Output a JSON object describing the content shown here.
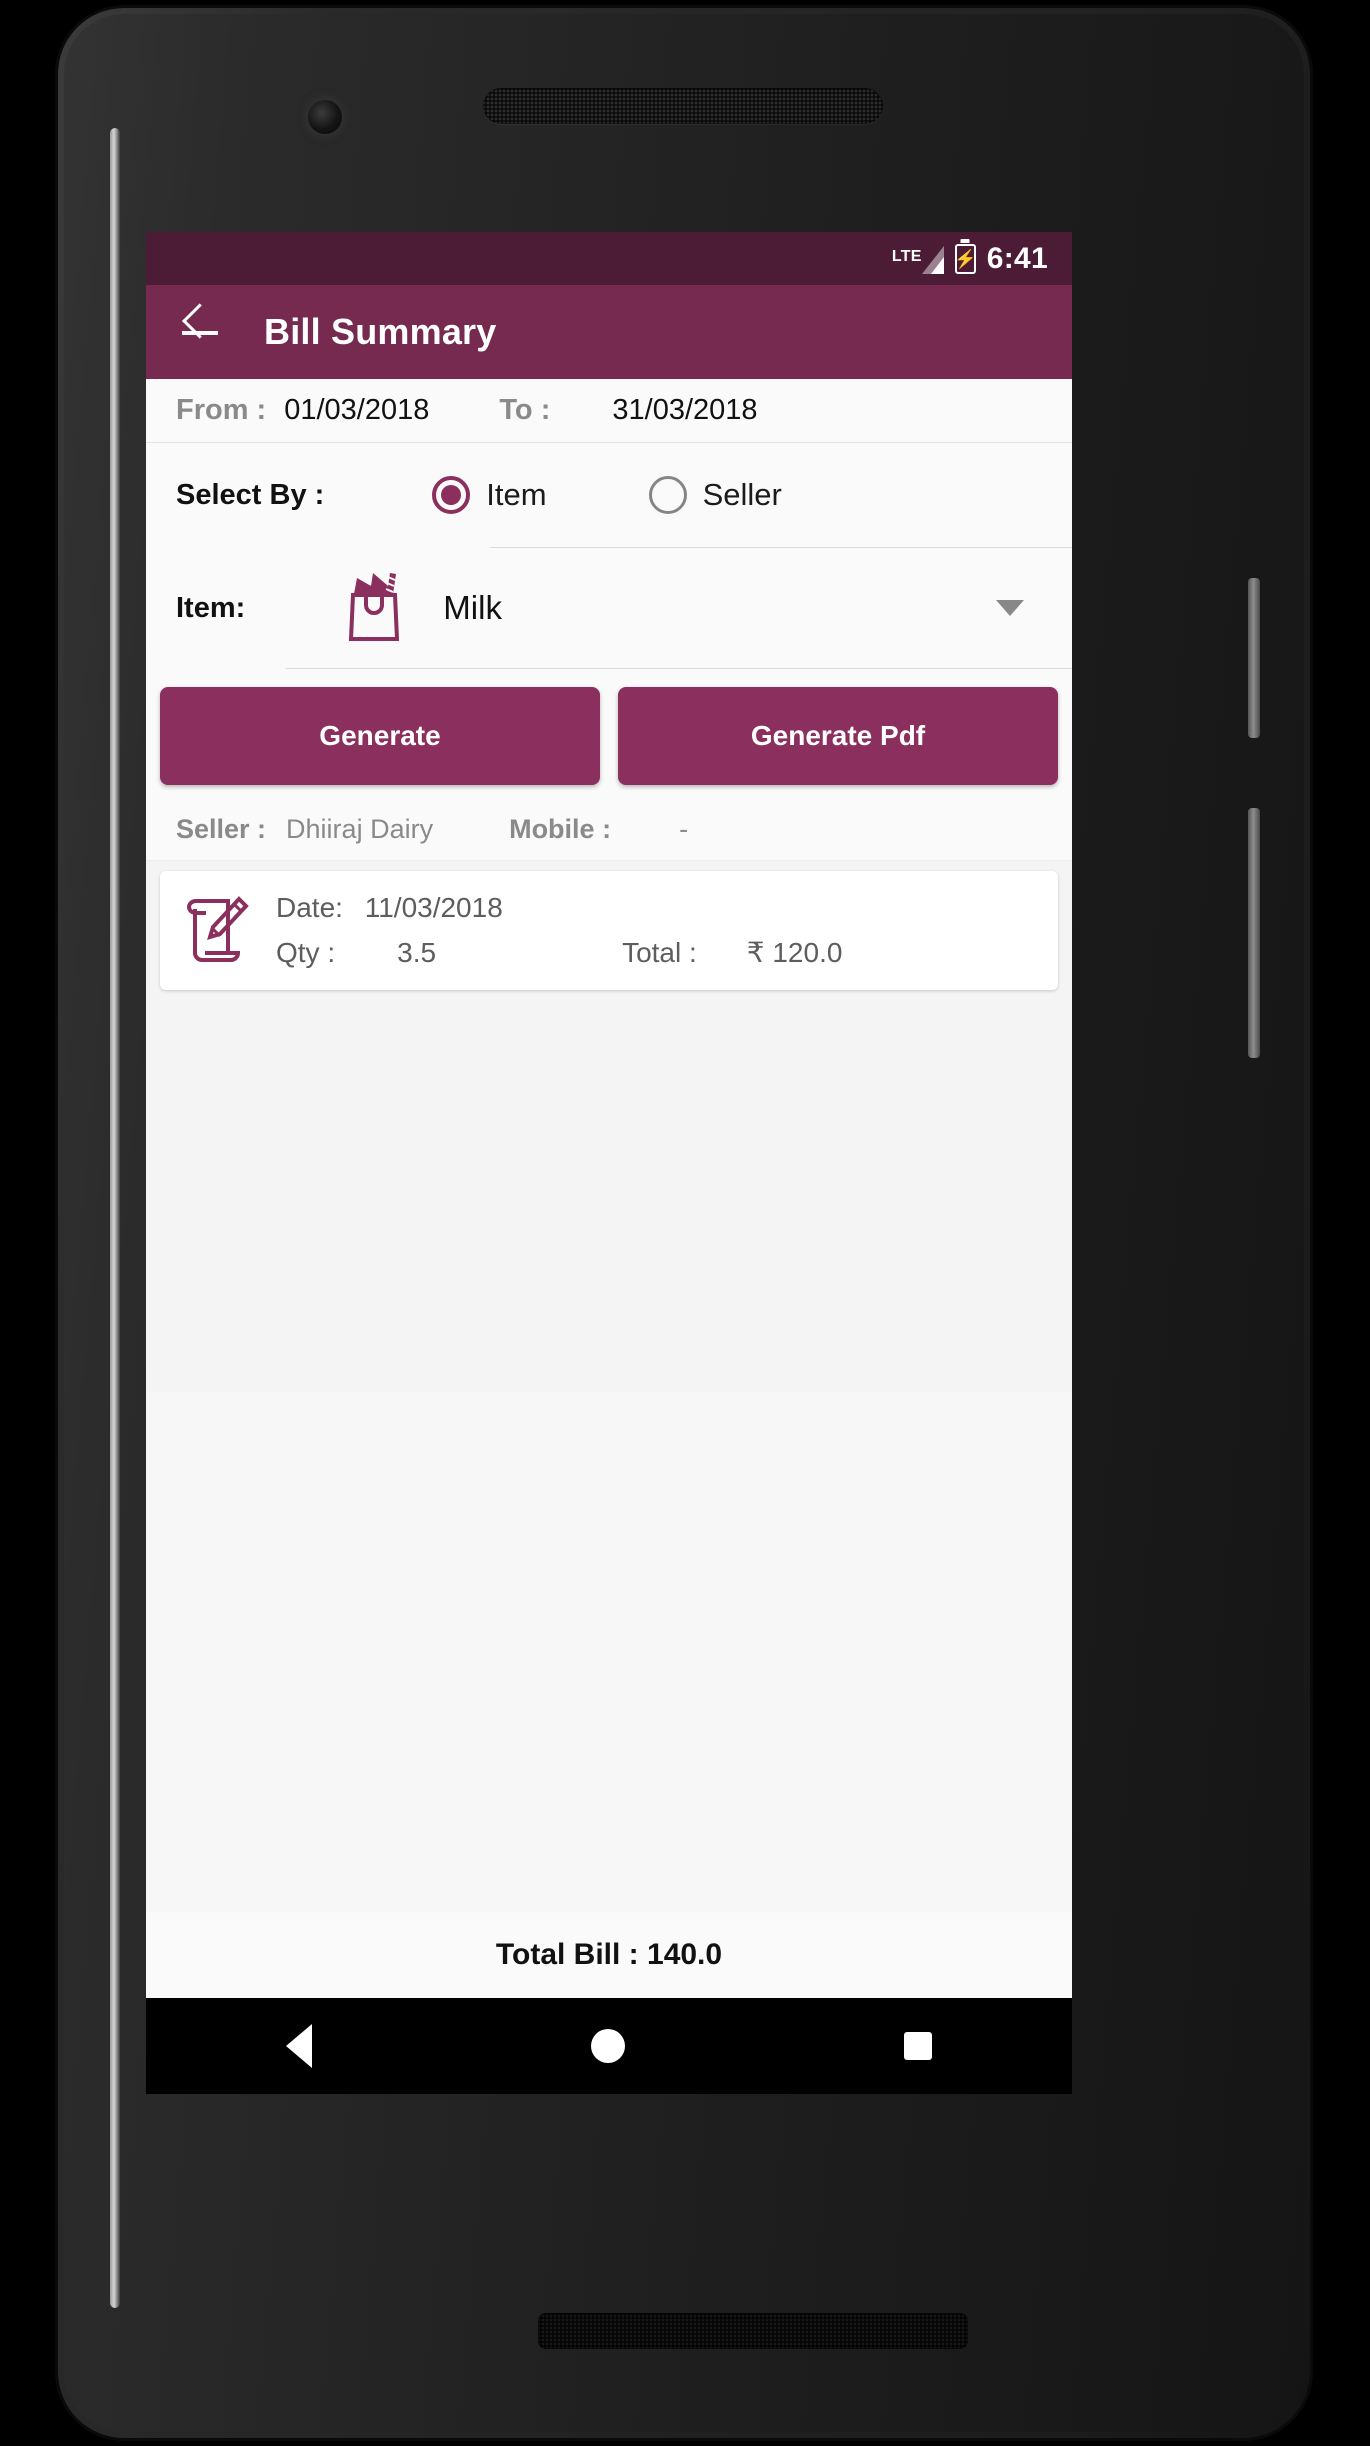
{
  "status_bar": {
    "network_label": "LTE",
    "clock": "6:41",
    "battery_state": "charging"
  },
  "app_bar": {
    "back_icon": "arrow-left-icon",
    "title": "Bill Summary"
  },
  "date_range": {
    "from_label": "From :",
    "from_value": "01/03/2018",
    "to_label": "To :",
    "to_value": "31/03/2018"
  },
  "select_by": {
    "label": "Select By :",
    "options": [
      {
        "label": "Item",
        "selected": true
      },
      {
        "label": "Seller",
        "selected": false
      }
    ]
  },
  "item_picker": {
    "label": "Item:",
    "icon": "shopping-bag-icon",
    "value": "Milk",
    "caret_icon": "chevron-down-icon"
  },
  "actions": {
    "generate_label": "Generate",
    "generate_pdf_label": "Generate Pdf"
  },
  "seller_info": {
    "seller_label": "Seller :",
    "seller_value": "Dhiiraj Dairy",
    "mobile_label": "Mobile :",
    "mobile_value": "-"
  },
  "records": [
    {
      "icon": "scroll-pencil-icon",
      "date_label": "Date:",
      "date_value": "11/03/2018",
      "qty_label": "Qty :",
      "qty_value": "3.5",
      "total_label": "Total :",
      "total_value": "₹ 120.0"
    }
  ],
  "footer": {
    "total_bill": "Total Bill : 140.0"
  },
  "nav_bar": {
    "back": "nav-back-icon",
    "home": "nav-home-icon",
    "recents": "nav-recents-icon"
  },
  "colors": {
    "status_bar": "#4c1c36",
    "app_bar": "#762a4f",
    "accent": "#8b2f5e",
    "screen_bg": "#fafafa",
    "list_bg": "#f4f4f4"
  }
}
